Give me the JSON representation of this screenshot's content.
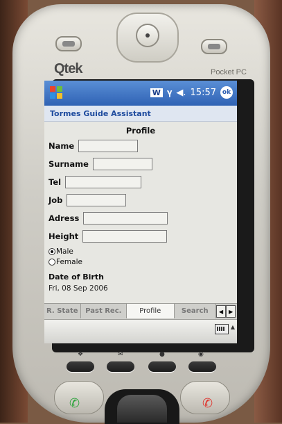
{
  "device": {
    "brand": "Qtek",
    "model": "Pocket PC"
  },
  "status": {
    "w_label": "W",
    "time": "15:57",
    "ok_label": "ok"
  },
  "app": {
    "title": "Tormes Guide Assistant"
  },
  "form": {
    "heading": "Profile",
    "fields": [
      {
        "label": "Name",
        "value": ""
      },
      {
        "label": "Surname",
        "value": ""
      },
      {
        "label": "Tel",
        "value": ""
      },
      {
        "label": "Job",
        "value": ""
      },
      {
        "label": "Adress",
        "value": ""
      },
      {
        "label": "Height",
        "value": ""
      }
    ],
    "gender": {
      "options": [
        "Male",
        "Female"
      ],
      "selected": "Male"
    },
    "dob_label": "Date of Birth",
    "dob_value": "Fri, 08 Sep 2006"
  },
  "tabs": [
    "R. State",
    "Past Rec.",
    "Profile",
    "Search"
  ],
  "active_tab": "Profile",
  "icons": [
    "windows-start-icon",
    "signal-icon",
    "volume-icon",
    "keyboard-icon",
    "scroll-left-icon",
    "scroll-right-icon",
    "call-answer-icon",
    "call-end-icon"
  ],
  "colors": {
    "titlebar": "#2f62b4",
    "app_title_text": "#1e4b9e"
  }
}
